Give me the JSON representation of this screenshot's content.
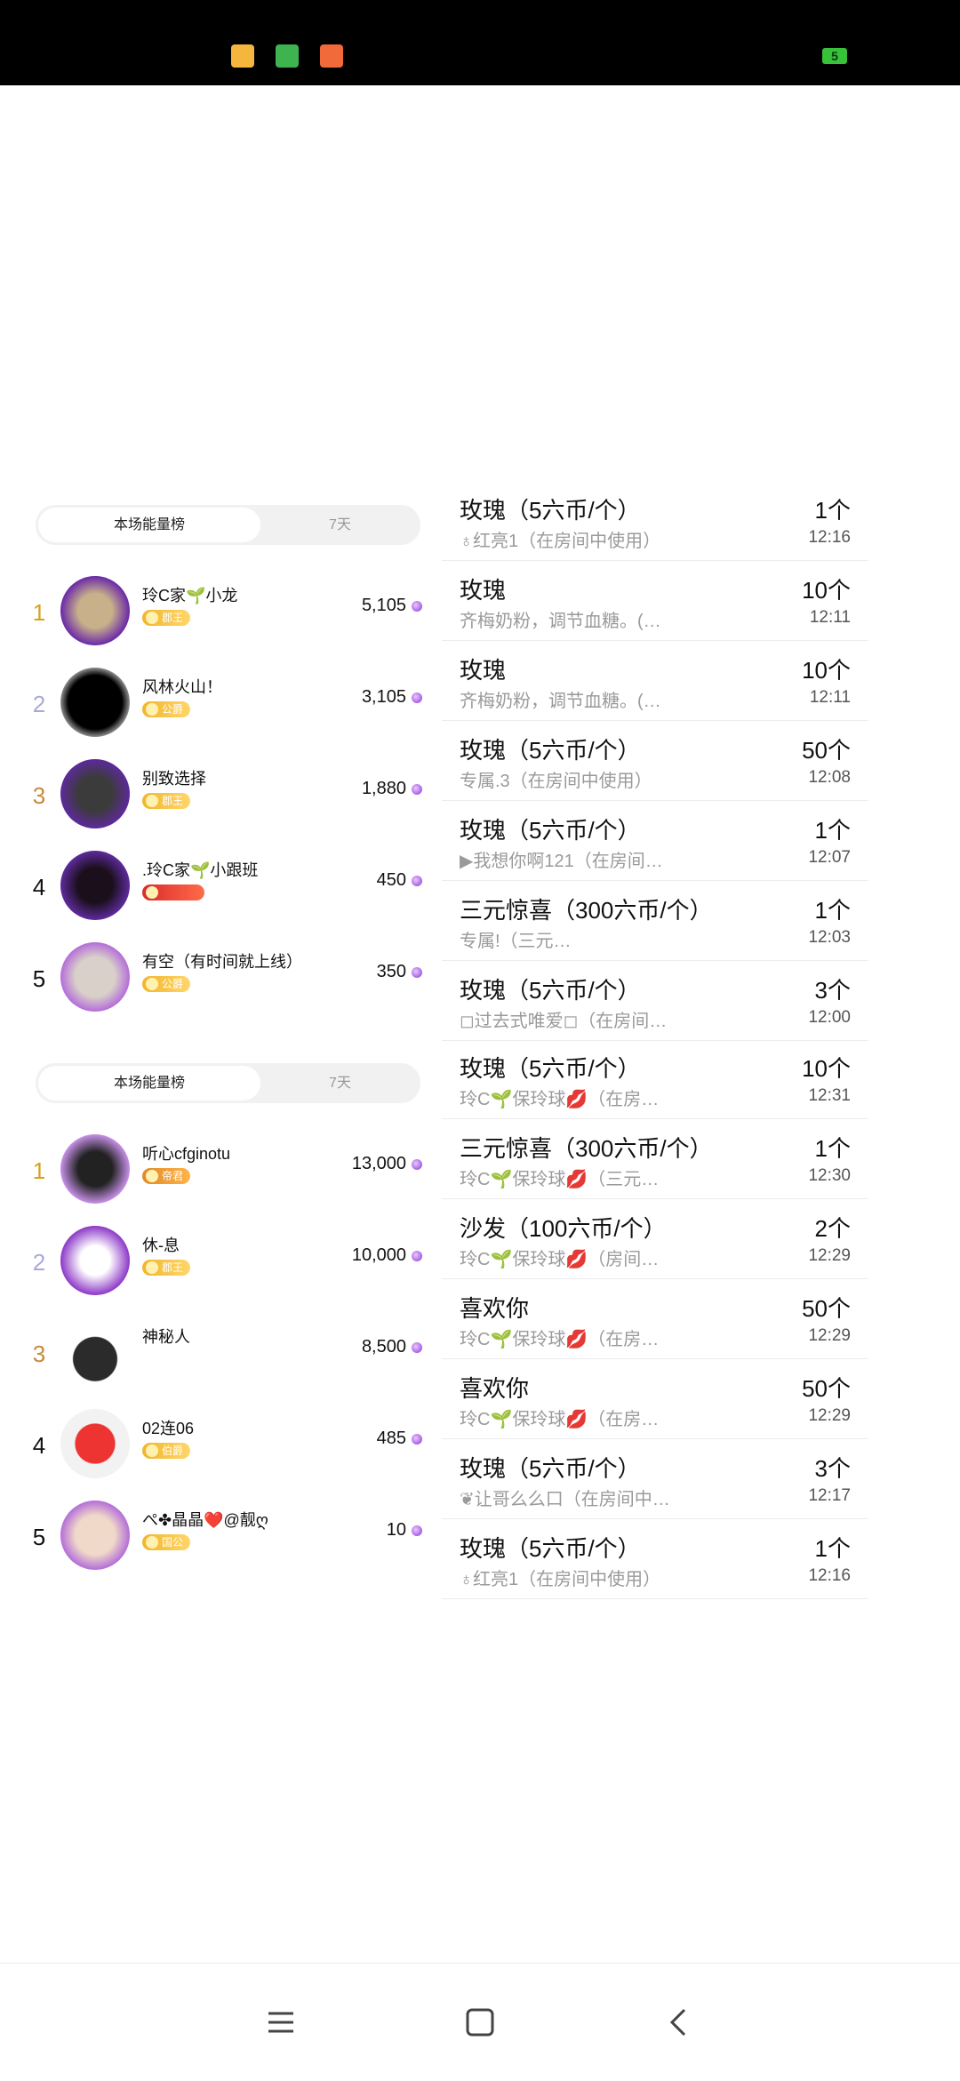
{
  "status_bar": {
    "icons": [
      "chat-icon",
      "android-icon",
      "shop-icon"
    ],
    "battery": "5"
  },
  "panel_a": {
    "tabs": [
      "本场能量榜",
      "7天"
    ],
    "rows": [
      {
        "rank": "1",
        "name": "玲C家🌱小龙",
        "badge": "郡王",
        "score": "5,105"
      },
      {
        "rank": "2",
        "name": "风林火山！",
        "badge": "公爵",
        "score": "3,105"
      },
      {
        "rank": "3",
        "name": "别致选择",
        "badge": "郡王",
        "score": "1,880"
      },
      {
        "rank": "4",
        "name": ".玲C家🌱小跟班",
        "badge": "",
        "score": "450"
      },
      {
        "rank": "5",
        "name": "有空（有时间就上线）",
        "badge": "公爵",
        "score": "350"
      }
    ]
  },
  "panel_b": {
    "tabs": [
      "本场能量榜",
      "7天"
    ],
    "rows": [
      {
        "rank": "1",
        "name": "听心cfginotu",
        "badge": "帝君",
        "score": "13,000"
      },
      {
        "rank": "2",
        "name": "休-息",
        "badge": "郡王",
        "score": "10,000"
      },
      {
        "rank": "3",
        "name": "神秘人",
        "badge": "",
        "score": "8,500"
      },
      {
        "rank": "4",
        "name": "02连06",
        "badge": "伯爵",
        "score": "485"
      },
      {
        "rank": "5",
        "name": "ぺ✤晶晶❤️@靓ღ",
        "badge": "国公",
        "score": "10"
      }
    ]
  },
  "gifts_a": [
    {
      "name": "玫瑰（5六币/个）",
      "sub": "♁红亮1（在房间中使用）",
      "count": "1个",
      "time": "12:16"
    },
    {
      "name": "玫瑰",
      "sub": "齐梅奶粉，调节血糖。(…",
      "count": "10个",
      "time": "12:11"
    },
    {
      "name": "玫瑰",
      "sub": "齐梅奶粉，调节血糖。(…",
      "count": "10个",
      "time": "12:11"
    },
    {
      "name": "玫瑰（5六币/个）",
      "sub": "专属.3（在房间中使用）",
      "count": "50个",
      "time": "12:08"
    },
    {
      "name": "玫瑰（5六币/个）",
      "sub": "▶我想你啊121（在房间…",
      "count": "1个",
      "time": "12:07"
    },
    {
      "name": "三元惊喜（300六币/个）",
      "sub": "专属!（三元…",
      "count": "1个",
      "time": "12:03"
    },
    {
      "name": "玫瑰（5六币/个）",
      "sub": "◻过去式唯爱◻（在房间…",
      "count": "3个",
      "time": "12:00"
    }
  ],
  "gifts_b": [
    {
      "name": "玫瑰（5六币/个）",
      "sub": "玲C🌱保玲球💋（在房…",
      "count": "10个",
      "time": "12:31"
    },
    {
      "name": "三元惊喜（300六币/个）",
      "sub": "玲C🌱保玲球💋（三元…",
      "count": "1个",
      "time": "12:30"
    },
    {
      "name": "沙发（100六币/个）",
      "sub": "玲C🌱保玲球💋（房间…",
      "count": "2个",
      "time": "12:29"
    },
    {
      "name": "喜欢你",
      "sub": "玲C🌱保玲球💋（在房…",
      "count": "50个",
      "time": "12:29"
    },
    {
      "name": "喜欢你",
      "sub": "玲C🌱保玲球💋（在房…",
      "count": "50个",
      "time": "12:29"
    },
    {
      "name": "玫瑰（5六币/个）",
      "sub": "❦让哥么么口（在房间中…",
      "count": "3个",
      "time": "12:17"
    },
    {
      "name": "玫瑰（5六币/个）",
      "sub": "♁红亮1（在房间中使用）",
      "count": "1个",
      "time": "12:16"
    }
  ],
  "nav": [
    "menu-icon",
    "home-icon",
    "back-icon"
  ]
}
